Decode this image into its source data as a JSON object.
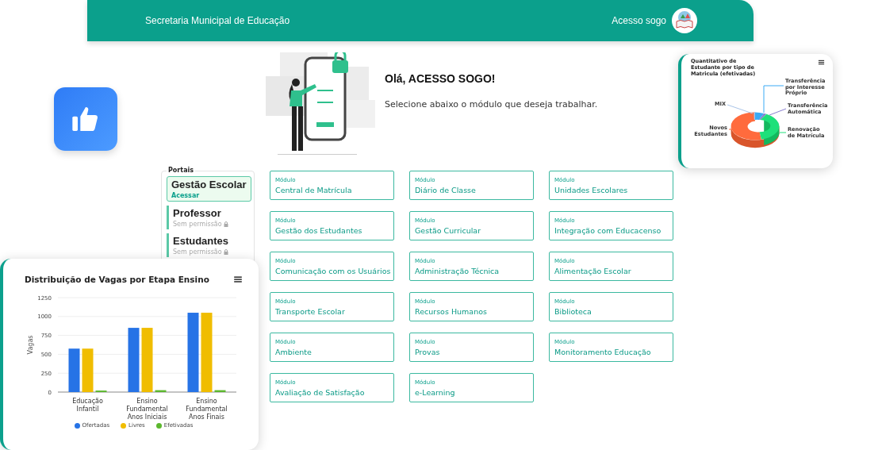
{
  "header": {
    "title": "Secretaria Municipal de Educação",
    "user_name": "Acesso sogo"
  },
  "greeting": {
    "title": "Olá, ACESSO SOGO!",
    "subtitle": "Selecione abaixo o módulo que deseja trabalhar."
  },
  "portals": {
    "title": "Portais",
    "items": [
      {
        "name": "Gestão Escolar",
        "status": "Acessar",
        "selected": true,
        "locked": false
      },
      {
        "name": "Professor",
        "status": "Sem permissão",
        "selected": false,
        "locked": true
      },
      {
        "name": "Estudantes",
        "status": "Sem permissão",
        "selected": false,
        "locked": true
      }
    ]
  },
  "modules": [
    {
      "caption": "Módulo",
      "name": "Central de Matrícula"
    },
    {
      "caption": "Módulo",
      "name": "Diário de Classe"
    },
    {
      "caption": "Módulo",
      "name": "Unidades Escolares"
    },
    {
      "caption": "Módulo",
      "name": "Gestão dos Estudantes"
    },
    {
      "caption": "Módulo",
      "name": "Gestão Curricular"
    },
    {
      "caption": "Módulo",
      "name": "Integração com Educacenso"
    },
    {
      "caption": "Módulo",
      "name": "Comunicação com os Usuários"
    },
    {
      "caption": "Módulo",
      "name": "Administração Técnica"
    },
    {
      "caption": "Módulo",
      "name": "Alimentação Escolar"
    },
    {
      "caption": "Módulo",
      "name": "Transporte Escolar"
    },
    {
      "caption": "Módulo",
      "name": "Recursos Humanos"
    },
    {
      "caption": "Módulo",
      "name": "Biblioteca"
    },
    {
      "caption": "Módulo",
      "name": "Ambiente"
    },
    {
      "caption": "Módulo",
      "name": "Provas"
    },
    {
      "caption": "Módulo",
      "name": "Monitoramento Educação"
    },
    {
      "caption": "Módulo",
      "name": "Avaliação de Satisfação"
    },
    {
      "caption": "Módulo",
      "name": "e-Learning"
    }
  ],
  "pie_card": {
    "title": "Quantitativo de Estudante por tipo de Matricula (efetivadas)",
    "labels": [
      {
        "text": "Transferência por Interesse Próprio",
        "color": "#3aaaf5"
      },
      {
        "text": "MIX",
        "color": "#a9c4e8"
      },
      {
        "text": "Transferência Automática",
        "color": "#8a7fd0"
      },
      {
        "text": "Novos Estudantes",
        "color": "#ff6b3d"
      },
      {
        "text": "Renovação de Matrícula",
        "color": "#1ee07a"
      }
    ]
  },
  "bar_card": {
    "chart_data": {
      "type": "bar",
      "title": "Distribuição de Vagas por Etapa Ensino",
      "ylabel": "Vagas",
      "categories": [
        "Educação Infantil",
        "Ensino Fundamental Anos Iniciais",
        "Ensino Fundamental Anos Finais"
      ],
      "ylim": [
        0,
        1250
      ],
      "yticks": [
        0,
        250,
        500,
        750,
        1000,
        1250
      ],
      "grid": true,
      "legend": "bottom",
      "series": [
        {
          "name": "Ofertadas",
          "color": "#2673e6",
          "values": [
            575,
            850,
            1050
          ]
        },
        {
          "name": "Livres",
          "color": "#f0bd00",
          "values": [
            575,
            850,
            1050
          ]
        },
        {
          "name": "Efetivadas",
          "color": "#5cb82e",
          "values": [
            20,
            25,
            25
          ]
        }
      ]
    }
  }
}
